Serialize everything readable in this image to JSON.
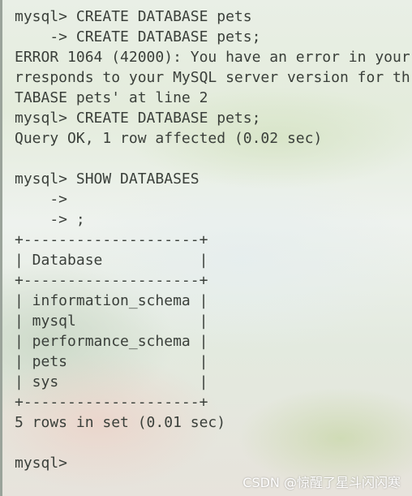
{
  "terminal": {
    "lines": [
      "mysql> CREATE DATABASE pets",
      "    -> CREATE DATABASE pets;",
      "ERROR 1064 (42000): You have an error in your",
      "rresponds to your MySQL server version for th",
      "TABASE pets' at line 2",
      "mysql> CREATE DATABASE pets;",
      "Query OK, 1 row affected (0.02 sec)",
      "",
      "mysql> SHOW DATABASES",
      "    ->",
      "    -> ;",
      "+--------------------+",
      "| Database           |",
      "+--------------------+",
      "| information_schema |",
      "| mysql              |",
      "| performance_schema |",
      "| pets               |",
      "| sys                |",
      "+--------------------+",
      "5 rows in set (0.01 sec)",
      "",
      "mysql>"
    ]
  },
  "watermark": {
    "text": "CSDN @惊醒了星斗闪闪寒"
  }
}
